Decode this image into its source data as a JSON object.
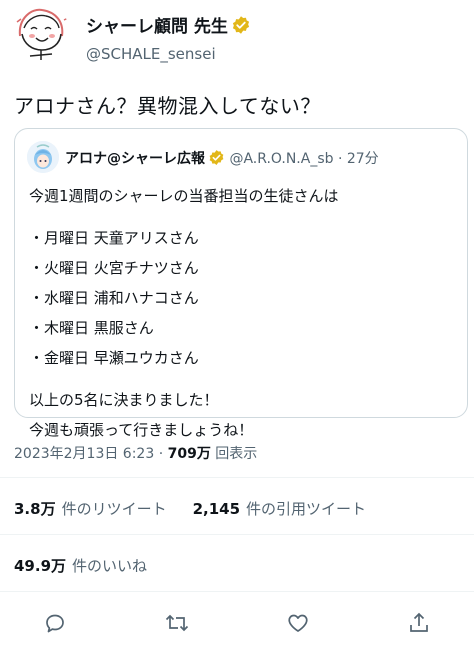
{
  "author": {
    "name": "シャーレ顧問 先生",
    "handle": "@SCHALE_sensei",
    "verified": true
  },
  "tweet": {
    "text": "アロナさん？異物混入してない？"
  },
  "quote": {
    "name": "アロナ@シャーレ広報",
    "handle": "@A.R.O.N.A_sb",
    "time": "27分",
    "lines": [
      "今週1週間のシャーレの当番担当の生徒さんは",
      "",
      "・月曜日 天童アリスさん",
      "・火曜日 火宮チナツさん",
      "・水曜日 浦和ハナコさん",
      "・木曜日 黒服さん",
      "・金曜日 早瀬ユウカさん",
      "",
      "以上の5名に決まりました！",
      "今週も頑張って行きましょうね！"
    ]
  },
  "meta": {
    "datetime": "2023年2月13日 6:23",
    "separator": "·",
    "views": "709万",
    "views_label": "回表示"
  },
  "stats": {
    "retweets": "3.8万",
    "retweets_label": "件のリツイート",
    "quotes": "2,145",
    "quotes_label": "件の引用ツイート",
    "likes": "49.9万",
    "likes_label": "件のいいね"
  },
  "actions": [
    "reply-icon",
    "retweet-icon",
    "like-icon",
    "share-icon"
  ],
  "colors": {
    "verified_gold": "#e2b719",
    "secondary_text": "#536471",
    "border": "#cfd9de"
  }
}
